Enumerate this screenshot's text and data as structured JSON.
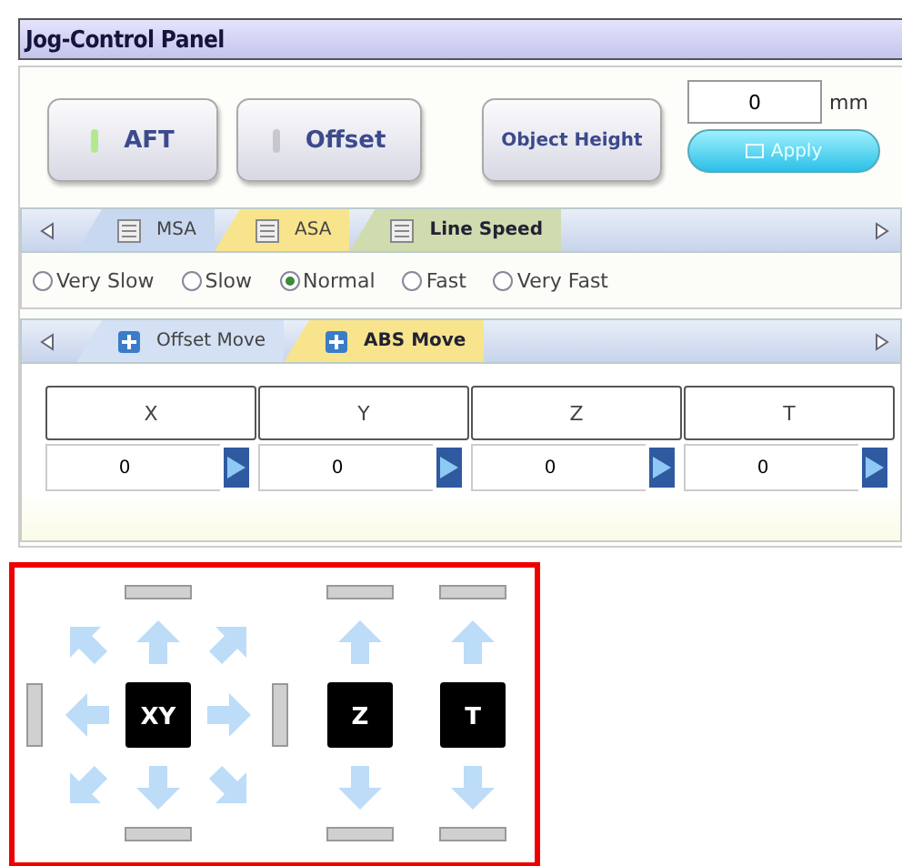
{
  "title": "Jog-Control Panel",
  "mode_buttons": [
    {
      "label": "AFT",
      "on": true
    },
    {
      "label": "Offset",
      "on": false
    }
  ],
  "object_height": {
    "button": "Object Height",
    "value": "0",
    "unit": "mm",
    "apply": "Apply"
  },
  "speed_tabs": [
    {
      "label": "MSA",
      "selected": false,
      "color": "#c8d8f0"
    },
    {
      "label": "ASA",
      "selected": false,
      "color": "#f8e48c"
    },
    {
      "label": "Line Speed",
      "selected": true,
      "color": "#d0dcb0"
    }
  ],
  "speeds": [
    {
      "label": "Very Slow",
      "selected": false
    },
    {
      "label": "Slow",
      "selected": false
    },
    {
      "label": "Normal",
      "selected": true
    },
    {
      "label": "Fast",
      "selected": false
    },
    {
      "label": "Very Fast",
      "selected": false
    }
  ],
  "move_tabs": [
    {
      "label": "Offset Move",
      "selected": false
    },
    {
      "label": "ABS Move",
      "selected": true
    }
  ],
  "axes": [
    {
      "name": "X",
      "value": "0"
    },
    {
      "name": "Y",
      "value": "0"
    },
    {
      "name": "Z",
      "value": "0"
    },
    {
      "name": "T",
      "value": "0"
    }
  ],
  "jog_pads": [
    {
      "label": "XY",
      "kind": "planar"
    },
    {
      "label": "Z",
      "kind": "linear"
    },
    {
      "label": "T",
      "kind": "linear"
    }
  ]
}
